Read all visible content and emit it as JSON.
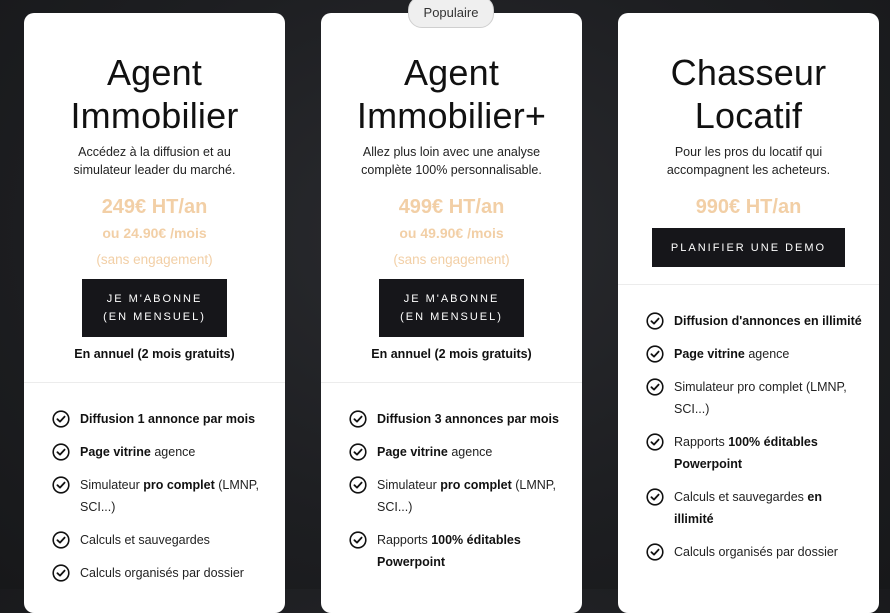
{
  "badge": "Populaire",
  "plans": [
    {
      "title_line1": "Agent",
      "title_line2": "Immobilier",
      "desc_line1": "Accédez à la diffusion et au",
      "desc_line2": "simulateur leader du marché.",
      "price": "249€ HT/an",
      "monthly": "ou 24.90€ /mois",
      "engagement": "(sans engagement)",
      "button_line1": "JE M'ABONNE",
      "button_line2": "(EN MENSUEL)",
      "annual": "En annuel (2 mois gratuits)",
      "features": [
        {
          "bold": "Diffusion 1 annonce par mois",
          "rest": ""
        },
        {
          "bold": "Page vitrine",
          "rest": " agence"
        },
        {
          "pre": "Simulateur ",
          "bold": "pro complet",
          "rest": " (LMNP, SCI...)"
        },
        {
          "pre": "Calculs et sauvegardes",
          "bold": "",
          "rest": ""
        },
        {
          "pre": "Calculs organisés par dossier",
          "bold": "",
          "rest": ""
        }
      ]
    },
    {
      "title_line1": "Agent",
      "title_line2": "Immobilier+",
      "desc_line1": "Allez plus loin avec une analyse",
      "desc_line2": "complète 100% personnalisable.",
      "price": "499€ HT/an",
      "monthly": "ou 49.90€ /mois",
      "engagement": "(sans engagement)",
      "button_line1": "JE M'ABONNE",
      "button_line2": "(EN MENSUEL)",
      "annual": "En annuel (2 mois gratuits)",
      "features": [
        {
          "bold": "Diffusion 3 annonces par mois",
          "rest": ""
        },
        {
          "bold": "Page vitrine",
          "rest": " agence"
        },
        {
          "pre": "Simulateur ",
          "bold": "pro complet",
          "rest": " (LMNP, SCI...)"
        },
        {
          "pre": "Rapports ",
          "bold": "100% éditables Powerpoint",
          "rest": ""
        }
      ]
    },
    {
      "title_line1": "Chasseur",
      "title_line2": "Locatif",
      "desc_line1": "Pour les pros du locatif qui",
      "desc_line2": "accompagnent les acheteurs.",
      "price": "990€ HT/an",
      "button_label": "PLANIFIER UNE DEMO",
      "features": [
        {
          "bold": "Diffusion d'annonces en illimité",
          "rest": ""
        },
        {
          "bold": "Page vitrine",
          "rest": " agence"
        },
        {
          "pre": "Simulateur pro complet (LMNP, SCI...)",
          "bold": "",
          "rest": ""
        },
        {
          "pre": "Rapports ",
          "bold": "100% éditables Powerpoint",
          "rest": ""
        },
        {
          "pre": "Calculs et sauvegardes ",
          "bold": "en illimité",
          "rest": ""
        },
        {
          "pre": "Calculs organisés par dossier",
          "bold": "",
          "rest": ""
        }
      ]
    }
  ],
  "icons": {
    "check": "check-circle-icon"
  },
  "colors": {
    "price": "#f2cfa6",
    "button": "#16161a"
  }
}
